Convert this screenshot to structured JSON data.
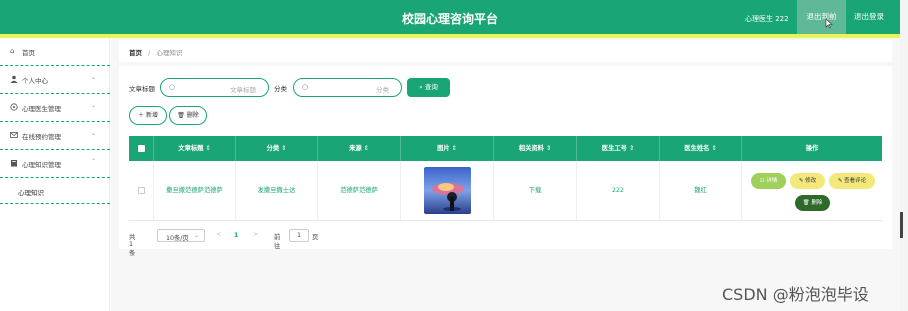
{
  "header": {
    "title": "校园心理咨询平台",
    "user_label": "心理医生 222",
    "exit_backend": "退出到前台",
    "logout": "退出登录"
  },
  "sidebar": {
    "items": [
      {
        "label": "首页",
        "icon": "home-icon"
      },
      {
        "label": "个人中心",
        "icon": "user-icon"
      },
      {
        "label": "心理医生管理",
        "icon": "doctor-icon"
      },
      {
        "label": "在线预约管理",
        "icon": "mail-icon"
      },
      {
        "label": "心理知识管理",
        "icon": "book-icon"
      }
    ],
    "sub_item": "心理知识"
  },
  "breadcrumb": {
    "home": "首页",
    "separator": "/",
    "current": "心理知识"
  },
  "search": {
    "title_label": "文章标题",
    "title_placeholder": "文章标题",
    "category_label": "分类",
    "category_placeholder": "分类",
    "query_button": "查询"
  },
  "actions": {
    "add": "新增",
    "delete": "删除"
  },
  "table": {
    "columns": [
      "文章标题",
      "分类",
      "来源",
      "图片",
      "相关资料",
      "医生工号",
      "医生姓名",
      "操作"
    ],
    "rows": [
      {
        "title": "撒旦撒范德萨范德萨",
        "category": "发撒旦撒士达",
        "source": "范德萨范德萨",
        "material": "下载",
        "doctor_id": "222",
        "doctor_name": "魏红"
      }
    ],
    "row_actions": {
      "detail": "详情",
      "edit": "修改",
      "review": "查看评论",
      "delete": "删除"
    }
  },
  "pager": {
    "total": "共 1 条",
    "page_size": "10条/页",
    "prev": "<",
    "current": "1",
    "next": ">",
    "goto": "前往",
    "goto_value": "1",
    "unit": "页"
  },
  "watermark": "CSDN @粉泡泡毕设",
  "colors": {
    "primary": "#1aa577",
    "accent_line": "#e8f55a",
    "detail_btn": "#9fd05a",
    "edit_btn": "#f3e97a",
    "delete_btn": "#2f6a2a"
  }
}
